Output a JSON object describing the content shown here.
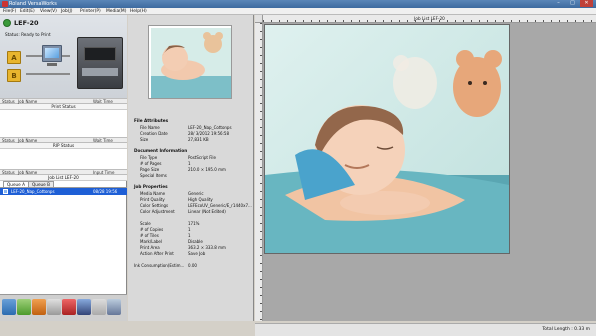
{
  "window": {
    "title": "Roland VersaWorks",
    "minimize": "–",
    "maximize": "□",
    "close": "✕"
  },
  "menu": [
    "File(F)",
    "Edit(E)",
    "View(V)",
    "Job(J)",
    "Printer(P)",
    "Media(M)",
    "Help(H)"
  ],
  "printer": {
    "name": "LEF-20",
    "status": "Status: Ready to Print"
  },
  "queue_a_label": "A",
  "queue_b_label": "B",
  "print_list": {
    "headers": [
      "Status",
      "Job Name",
      "Wait Time"
    ],
    "folder_status": "Print Status"
  },
  "rip_list": {
    "headers": [
      "Status",
      "Job Name",
      "Wait Time"
    ],
    "folder_status": "RIP Status"
  },
  "job_list": {
    "headers": [
      "Status",
      "Job Name",
      "Input Time"
    ],
    "title": "Job List LEF-20",
    "tabs": [
      "Queue A",
      "Queue B"
    ],
    "rows": [
      {
        "name": "LEF-20_Nap_Cottonps",
        "time": "08/28 19:56"
      }
    ]
  },
  "file_attributes": {
    "title": "File Attributes",
    "items": [
      {
        "k": "File Name",
        "v": "LEF-20_Nap_Cottonps"
      },
      {
        "k": "Creation Date",
        "v": "28/ 3/2012 19:56:58"
      },
      {
        "k": "Size",
        "v": "27,831 KB"
      }
    ]
  },
  "document_information": {
    "title": "Document Information",
    "items": [
      {
        "k": "File Type",
        "v": "PostScript File"
      },
      {
        "k": "# of Pages",
        "v": "1"
      },
      {
        "k": "Page Size",
        "v": "210.0 × 195.0 mm"
      },
      {
        "k": "Special Items",
        "v": ""
      }
    ]
  },
  "job_properties": {
    "title": "Job Properties",
    "items": [
      {
        "k": "Media Name",
        "v": "Generic"
      },
      {
        "k": "Print Quality",
        "v": "High Quality"
      },
      {
        "k": "Color Settings",
        "v": "LEFEcoUV_Generic/E_r1440x7..."
      },
      {
        "k": "Color Adjustment",
        "v": "Linear (Not Edited)"
      },
      {
        "k": "",
        "v": ""
      },
      {
        "k": "Scale",
        "v": "171%"
      },
      {
        "k": "# of Copies",
        "v": "1"
      },
      {
        "k": "# of Tiles",
        "v": "1"
      },
      {
        "k": "Mark/Label",
        "v": "Disable"
      },
      {
        "k": "Print Area",
        "v": "363.2 × 333.8 mm"
      },
      {
        "k": "Action After Print",
        "v": "Save Job"
      },
      {
        "k": "",
        "v": ""
      },
      {
        "k": "Ink Consumption(Estim...",
        "v": "0.00"
      }
    ]
  },
  "preview": {
    "title": "Job List LEF-20"
  },
  "status_bar": {
    "total_length": "Total Length : 0.33 m"
  },
  "colors": {
    "title_bar": "#4876ac",
    "selection": "#1e5fd6",
    "photo_bg": "#cfe9e6"
  },
  "icons": [
    "restore-icon",
    "document-icon",
    "folder-a-icon",
    "folder-b-icon"
  ]
}
